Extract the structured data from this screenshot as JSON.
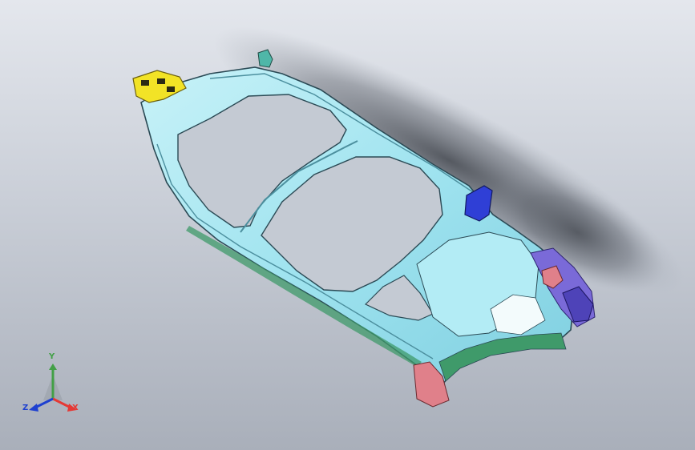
{
  "viewport": {
    "model": "body-side-frame",
    "colors": {
      "background_top": "#e4e7ed",
      "background_bottom": "#a9afba",
      "panel": "#9fe3ef",
      "panel_shade": "#7fcfe0",
      "edge": "#2b4a55",
      "bracket_yellow": "#f2e326",
      "bracket_blue": "#2f3fd6",
      "bracket_purple": "#7a6ad8",
      "bracket_red": "#e0808a",
      "sill_green": "#3f9a6a"
    }
  },
  "triad": {
    "x_label": "X",
    "y_label": "Y",
    "z_label": "Z",
    "x_color": "#e53935",
    "y_color": "#43a047",
    "z_color": "#1e40d0"
  }
}
